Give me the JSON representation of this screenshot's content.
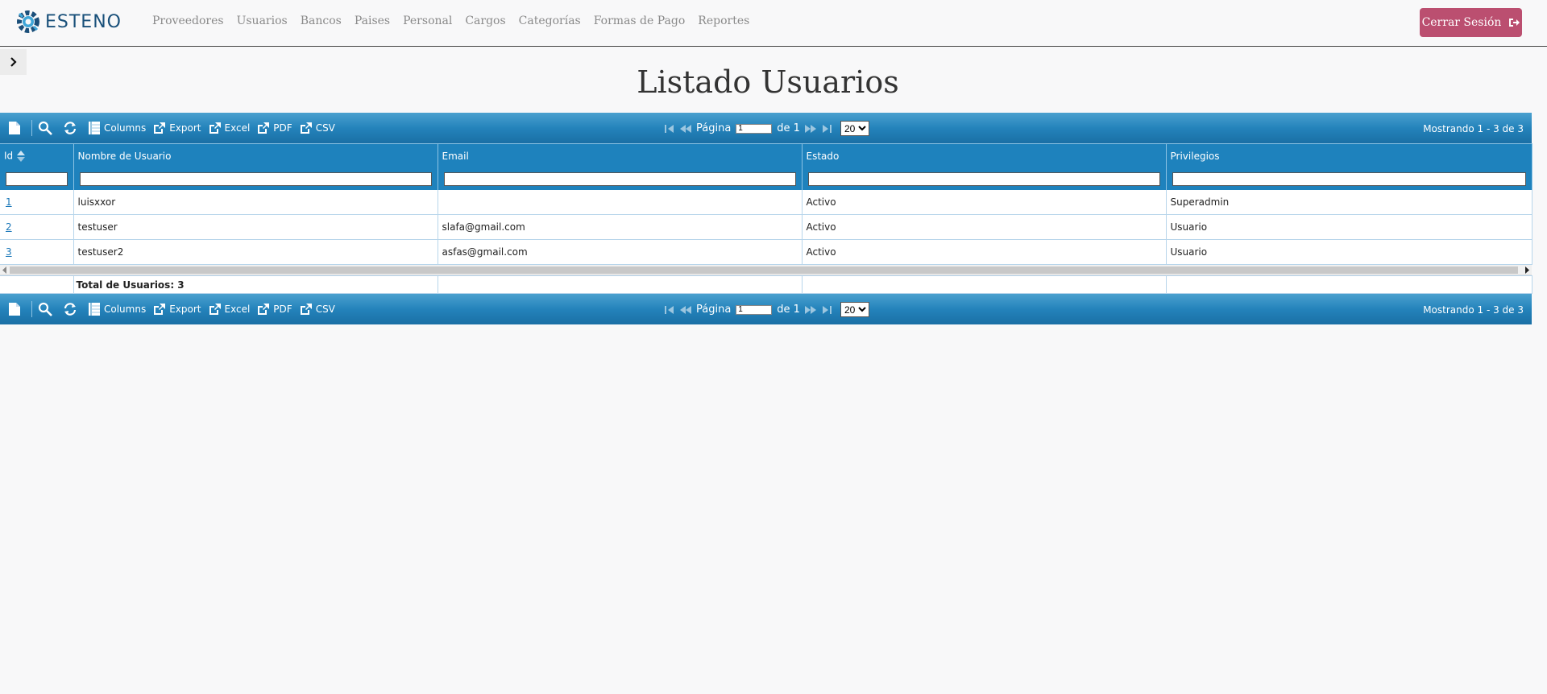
{
  "brand": {
    "name": "ESTENO"
  },
  "nav": {
    "links": [
      "Proveedores",
      "Usuarios",
      "Bancos",
      "Paises",
      "Personal",
      "Cargos",
      "Categorías",
      "Formas de Pago",
      "Reportes"
    ],
    "logout_label": "Cerrar Sesión"
  },
  "page": {
    "title": "Listado Usuarios"
  },
  "toolbar": {
    "columns_label": "Columns",
    "export_label": "Export",
    "excel_label": "Excel",
    "pdf_label": "PDF",
    "csv_label": "CSV",
    "page_label": "Página",
    "page_value": "1",
    "of_label": "de 1",
    "page_size": "20",
    "showing": "Mostrando 1 - 3 de 3"
  },
  "table": {
    "columns": [
      "Id",
      "Nombre de Usuario",
      "Email",
      "Estado",
      "Privilegios"
    ],
    "rows": [
      [
        "1",
        "luisxxor",
        "",
        "Activo",
        "Superadmin"
      ],
      [
        "2",
        "testuser",
        "slafa@gmail.com",
        "Activo",
        "Usuario"
      ],
      [
        "3",
        "testuser2",
        "asfas@gmail.com",
        "Activo",
        "Usuario"
      ]
    ],
    "footer_total": "Total de Usuarios: 3"
  },
  "colors": {
    "accent": "#1e82bd",
    "logout": "#bb4f70",
    "brand": "#19507a"
  },
  "icons": [
    "gear-logo-icon",
    "logout-icon",
    "chevron-right-icon",
    "add-document-icon",
    "search-icon",
    "refresh-icon",
    "columns-icon",
    "export-icon",
    "first-page-icon",
    "prev-page-icon",
    "next-page-icon",
    "last-page-icon",
    "sort-icon"
  ]
}
